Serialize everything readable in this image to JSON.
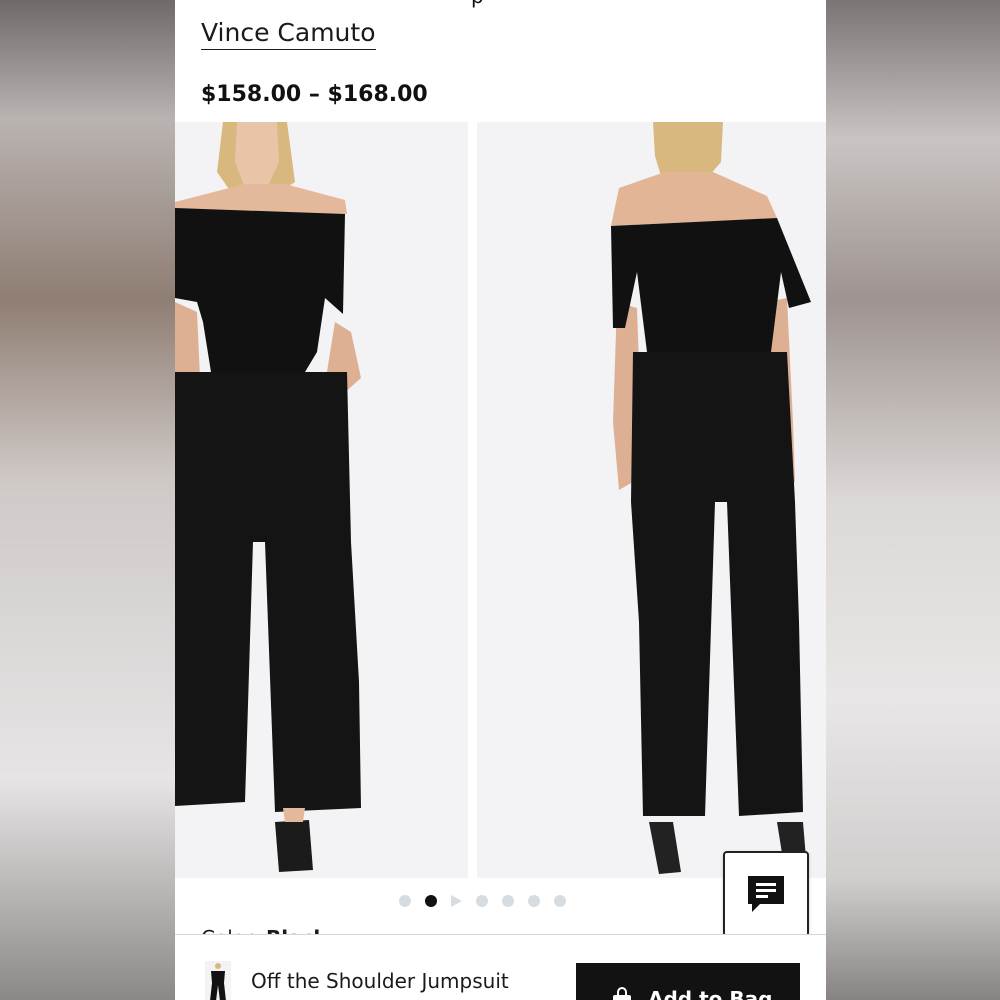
{
  "product": {
    "title_fragment": "p",
    "brand": "Vince Camuto",
    "price_range": "$158.00 – $168.00",
    "name": "Off the Shoulder Jumpsuit",
    "color_label": "Color:",
    "color_value": "Black"
  },
  "gallery": {
    "total_images": 7,
    "active_index": 1,
    "video_index": 2
  },
  "actions": {
    "add_to_bag_label": "Add to Bag",
    "chat_icon": "chat-icon",
    "bag_icon": "shopping-bag-icon"
  },
  "colors": {
    "garment": "#111111",
    "photo_bg": "#f3f2f4",
    "dot_inactive": "#d7dce1",
    "dot_active": "#111111",
    "button_bg": "#121212"
  }
}
